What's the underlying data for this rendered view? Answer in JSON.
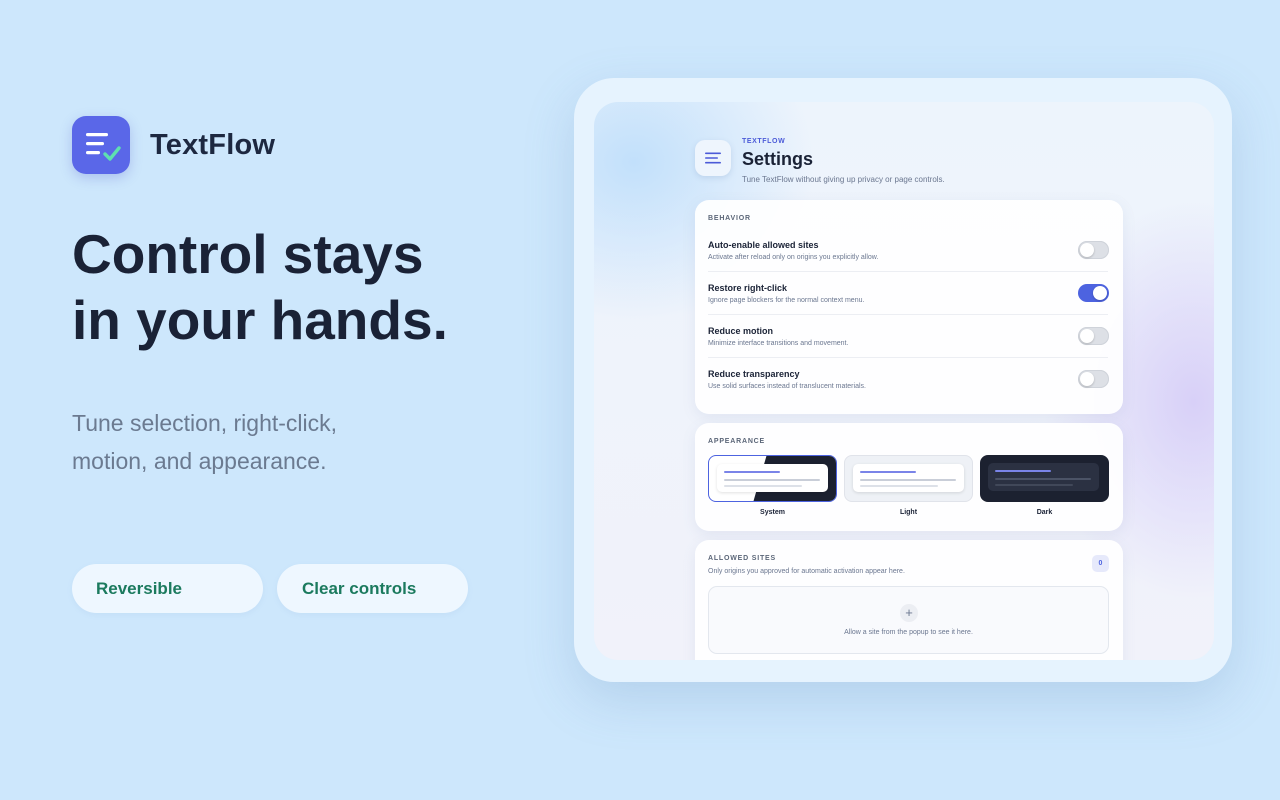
{
  "brand": {
    "name": "TextFlow",
    "logo_icon": "list-check-icon",
    "logo_color": "#5a67e8"
  },
  "hero": {
    "headline_line1": "Control stays",
    "headline_line2": "in your hands.",
    "sub_line1": "Tune selection, right-click,",
    "sub_line2": "motion, and appearance."
  },
  "pills": [
    "Reversible",
    "Clear controls"
  ],
  "settings": {
    "kicker": "TEXTFLOW",
    "title": "Settings",
    "description": "Tune TextFlow without giving up privacy or page controls.",
    "behavior": {
      "label": "BEHAVIOR",
      "items": [
        {
          "title": "Auto-enable allowed sites",
          "desc": "Activate after reload only on origins you explicitly allow.",
          "enabled": false
        },
        {
          "title": "Restore right-click",
          "desc": "Ignore page blockers for the normal context menu.",
          "enabled": true
        },
        {
          "title": "Reduce motion",
          "desc": "Minimize interface transitions and movement.",
          "enabled": false
        },
        {
          "title": "Reduce transparency",
          "desc": "Use solid surfaces instead of translucent materials.",
          "enabled": false
        }
      ]
    },
    "appearance": {
      "label": "APPEARANCE",
      "options": [
        "System",
        "Light",
        "Dark"
      ],
      "selected": "System"
    },
    "allowed_sites": {
      "label": "ALLOWED SITES",
      "description": "Only origins you approved for automatic activation appear here.",
      "count": "0",
      "empty_text": "Allow a site from the popup to see it here.",
      "add_icon": "+"
    }
  },
  "colors": {
    "accent": "#4d63e0",
    "pill_text": "#1b7a5e",
    "background": "#cde7fc"
  }
}
